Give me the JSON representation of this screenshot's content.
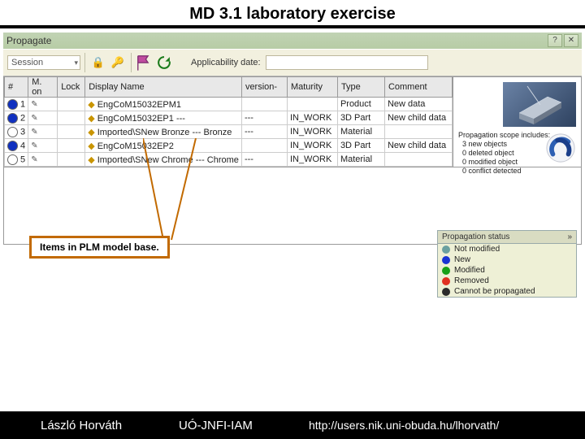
{
  "page": {
    "title": "MD 3.1 laboratory exercise"
  },
  "titlebar": {
    "label": "Propagate"
  },
  "toolbar": {
    "session_label": "Session",
    "applicability_label": "Applicability date:"
  },
  "columns": {
    "num": "#",
    "action": "M. on",
    "lock": "Lock",
    "name": "Display Name",
    "version": "version-",
    "maturity": "Maturity",
    "type": "Type",
    "comment": "Comment"
  },
  "rows": [
    {
      "n": "1",
      "state": "new",
      "name": "EngCoM15032EPM1",
      "ver": "",
      "mat": "",
      "type": "Product",
      "comment": "New data"
    },
    {
      "n": "2",
      "state": "new",
      "name": "EngCoM15032EP1 ---",
      "ver": "---",
      "mat": "IN_WORK",
      "type": "3D Part",
      "comment": "New child data"
    },
    {
      "n": "3",
      "state": "ex",
      "name": "Imported\\SNew Bronze --- Bronze",
      "ver": "---",
      "mat": "IN_WORK",
      "type": "Material",
      "comment": ""
    },
    {
      "n": "4",
      "state": "new",
      "name": "EngCoM15032EP2",
      "ver": "",
      "mat": "IN_WORK",
      "type": "3D Part",
      "comment": "New child data"
    },
    {
      "n": "5",
      "state": "ex",
      "name": "Imported\\SNew Chrome --- Chrome",
      "ver": "---",
      "mat": "IN_WORK",
      "type": "Material",
      "comment": ""
    }
  ],
  "scope": {
    "head": "Propagation scope includes:",
    "l1": "3 new objects",
    "l2": "0 deleted object",
    "l3": "0 modified object",
    "l4": "0 conflict detected"
  },
  "annot": {
    "items_label": "Items in PLM model base."
  },
  "status_box": {
    "header": "Propagation status",
    "items": [
      {
        "label": "Not modified",
        "color": "#6aa0a0"
      },
      {
        "label": "New",
        "color": "#1a34d4"
      },
      {
        "label": "Modified",
        "color": "#18a018"
      },
      {
        "label": "Removed",
        "color": "#e03020"
      },
      {
        "label": "Cannot be propagated",
        "color": "#2b2b2b"
      }
    ]
  },
  "footer": {
    "author": "László Horváth",
    "org": "UÓ-JNFI-IAM",
    "url": "http://users.nik.uni-obuda.hu/lhorvath/"
  }
}
